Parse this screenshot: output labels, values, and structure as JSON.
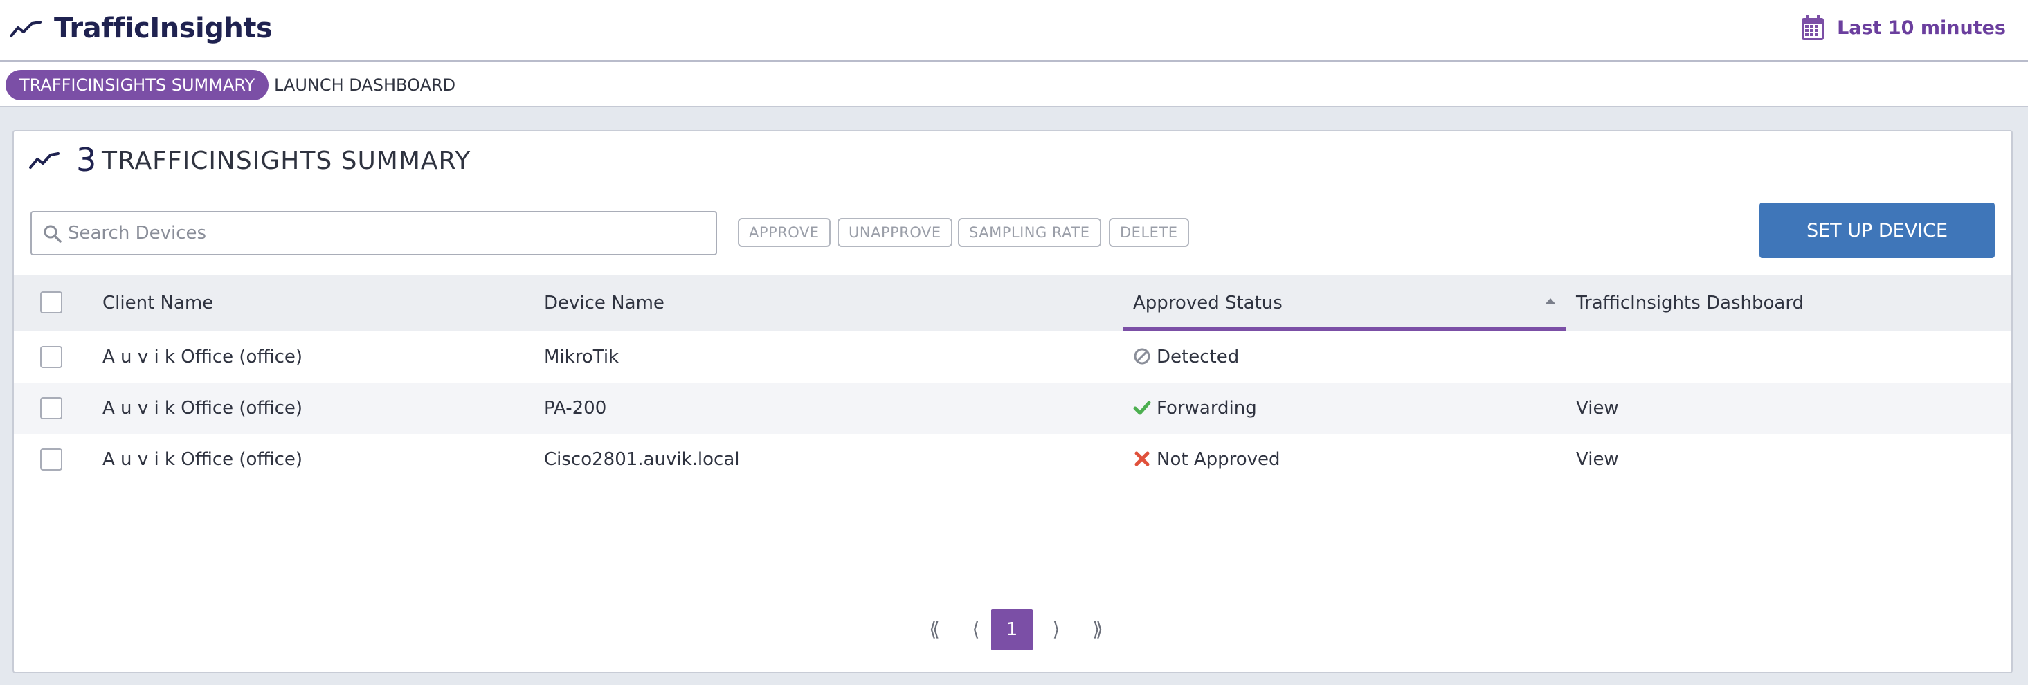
{
  "app": {
    "title": "TrafficInsights",
    "time_range": "Last 10 minutes"
  },
  "tabs": [
    {
      "label": "TRAFFICINSIGHTS SUMMARY",
      "active": true
    },
    {
      "label": "LAUNCH DASHBOARD",
      "active": false
    }
  ],
  "panel": {
    "count": "3",
    "title": "TRAFFICINSIGHTS SUMMARY",
    "search": {
      "placeholder": "Search Devices",
      "value": ""
    },
    "actions": [
      "APPROVE",
      "UNAPPROVE",
      "SAMPLING RATE",
      "DELETE"
    ],
    "setup_label": "SET UP DEVICE"
  },
  "table": {
    "columns": [
      "Client Name",
      "Device Name",
      "Approved Status",
      "TrafficInsights Dashboard"
    ],
    "sorted_column": "Approved Status",
    "rows": [
      {
        "client": "A u v i k Office (office)",
        "device": "MikroTik",
        "status": "Detected",
        "status_icon": "blocked-circle-icon",
        "dashboard": ""
      },
      {
        "client": "A u v i k Office (office)",
        "device": "PA-200",
        "status": "Forwarding",
        "status_icon": "check-icon",
        "dashboard": "View"
      },
      {
        "client": "A u v i k Office (office)",
        "device": "Cisco2801.auvik.local",
        "status": "Not Approved",
        "status_icon": "x-icon",
        "dashboard": "View"
      }
    ]
  },
  "pagination": {
    "first": "⟪",
    "prev": "⟨",
    "current": "1",
    "next": "⟩",
    "last": "⟫"
  },
  "colors": {
    "brand_purple": "#7b4fa6",
    "title_navy": "#1f2250",
    "setup_blue": "#3f76b9",
    "check_green": "#4caf50",
    "x_red": "#e0513b",
    "detected_gray": "#8a8e99"
  }
}
